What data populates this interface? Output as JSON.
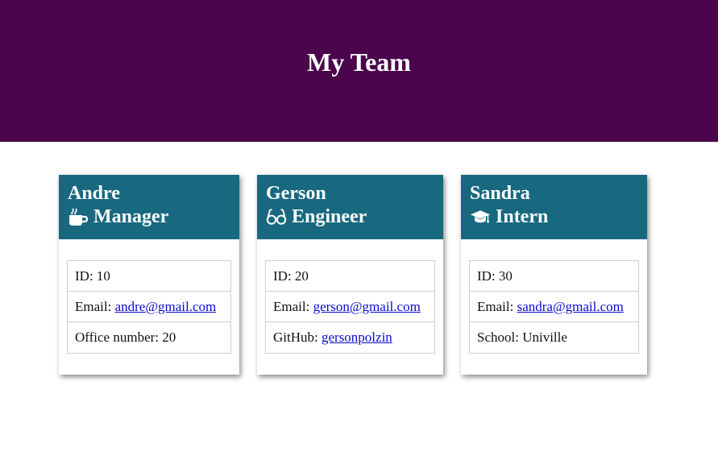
{
  "header": {
    "title": "My Team"
  },
  "cards": [
    {
      "name": "Andre",
      "role": "Manager",
      "icon": "coffee-icon",
      "id_label": "ID: ",
      "id_value": "10",
      "email_label": "Email: ",
      "email": "andre@gmail.com",
      "extra_label": "Office number: ",
      "extra_value": "20"
    },
    {
      "name": "Gerson",
      "role": "Engineer",
      "icon": "glasses-icon",
      "id_label": "ID: ",
      "id_value": "20",
      "email_label": "Email: ",
      "email": "gerson@gmail.com",
      "extra_label": "GitHub: ",
      "extra_value": "gersonpolzin"
    },
    {
      "name": "Sandra",
      "role": "Intern",
      "icon": "graduation-cap-icon",
      "id_label": "ID: ",
      "id_value": "30",
      "email_label": "Email: ",
      "email": "sandra@gmail.com",
      "extra_label": "School: ",
      "extra_value": "Univille"
    }
  ],
  "colors": {
    "header_bg": "#4a054c",
    "card_header_bg": "#186880",
    "link": "#0a0ad0"
  }
}
